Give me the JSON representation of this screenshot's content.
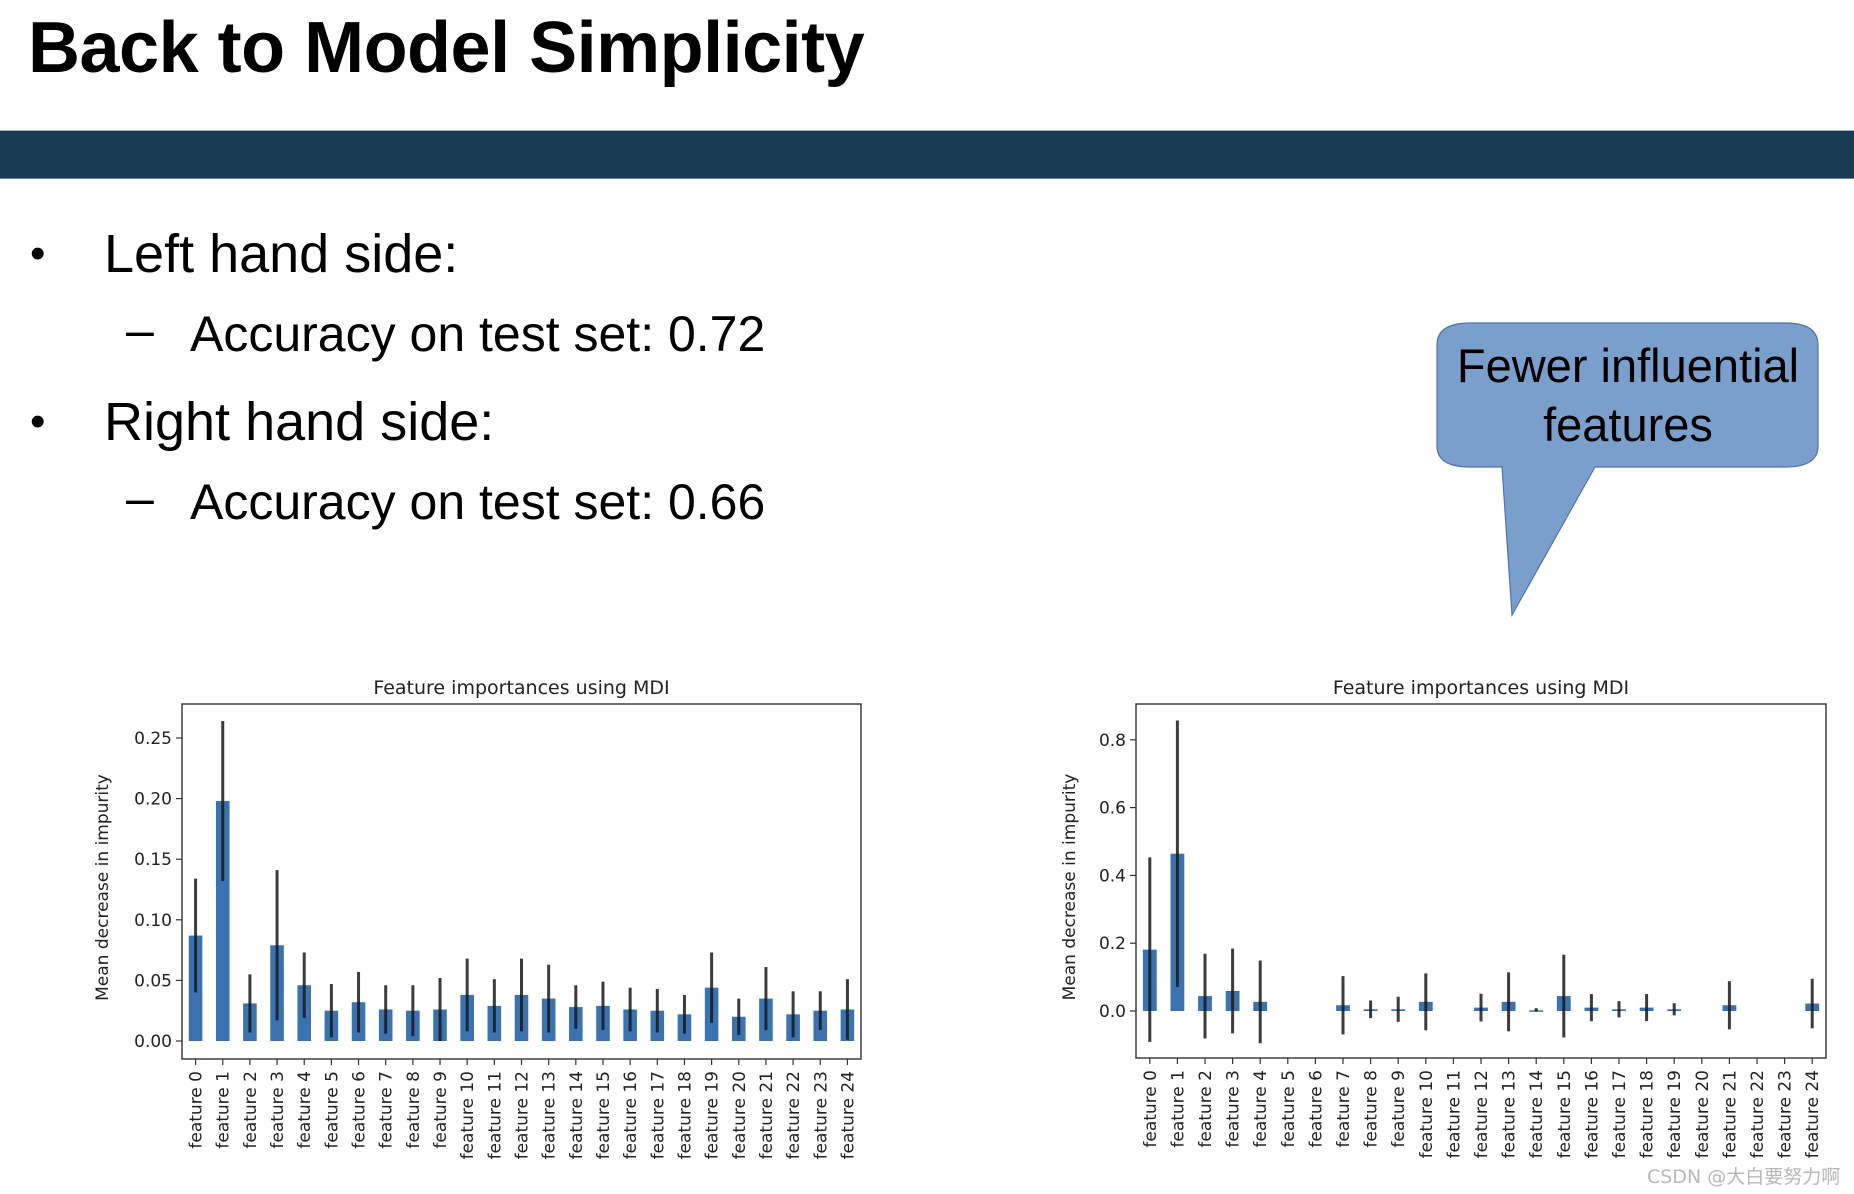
{
  "slide": {
    "title": "Back to Model Simplicity",
    "band_color": "#193a53",
    "bullets": [
      {
        "marker": "•",
        "text": "Left hand side:",
        "sub": {
          "marker": "–",
          "text": "Accuracy on test set: 0.72"
        }
      },
      {
        "marker": "•",
        "text": "Right hand side:",
        "sub": {
          "marker": "–",
          "text": "Accuracy on test set: 0.66"
        }
      }
    ],
    "callout": {
      "line1": "Fewer influential",
      "line2": "features",
      "fill": "#7b9fcc",
      "stroke": "#4f74a8"
    },
    "watermark": "CSDN @大白要努力啊"
  },
  "chart_data": [
    {
      "type": "bar",
      "title": "Feature importances using MDI",
      "xlabel": "",
      "ylabel": "Mean decrease in impurity",
      "ylim": [
        -0.017,
        0.275
      ],
      "yticks": [
        0.0,
        0.05,
        0.1,
        0.15,
        0.2,
        0.25
      ],
      "ytick_labels": [
        "0.00",
        "0.05",
        "0.10",
        "0.15",
        "0.20",
        "0.25"
      ],
      "grid": false,
      "bar_color": "#3a73b0",
      "errbar_color": "#1a1a1a",
      "categories": [
        "feature 0",
        "feature 1",
        "feature 2",
        "feature 3",
        "feature 4",
        "feature 5",
        "feature 6",
        "feature 7",
        "feature 8",
        "feature 9",
        "feature 10",
        "feature 11",
        "feature 12",
        "feature 13",
        "feature 14",
        "feature 15",
        "feature 16",
        "feature 17",
        "feature 18",
        "feature 19",
        "feature 20",
        "feature 21",
        "feature 22",
        "feature 23",
        "feature 24"
      ],
      "values": [
        0.087,
        0.198,
        0.031,
        0.079,
        0.046,
        0.025,
        0.032,
        0.026,
        0.025,
        0.026,
        0.038,
        0.029,
        0.038,
        0.035,
        0.028,
        0.029,
        0.026,
        0.025,
        0.022,
        0.044,
        0.02,
        0.035,
        0.022,
        0.025,
        0.026
      ],
      "error": [
        0.047,
        0.066,
        0.024,
        0.062,
        0.027,
        0.022,
        0.025,
        0.02,
        0.021,
        0.026,
        0.03,
        0.022,
        0.03,
        0.028,
        0.018,
        0.02,
        0.018,
        0.018,
        0.016,
        0.029,
        0.015,
        0.026,
        0.019,
        0.016,
        0.025
      ]
    },
    {
      "type": "bar",
      "title": "Feature importances using MDI",
      "xlabel": "",
      "ylabel": "Mean decrease in impurity",
      "ylim": [
        -0.14,
        0.9
      ],
      "yticks": [
        0.0,
        0.2,
        0.4,
        0.6,
        0.8
      ],
      "ytick_labels": [
        "0.0",
        "0.2",
        "0.4",
        "0.6",
        "0.8"
      ],
      "grid": false,
      "bar_color": "#3a73b0",
      "errbar_color": "#1a1a1a",
      "categories": [
        "feature 0",
        "feature 1",
        "feature 2",
        "feature 3",
        "feature 4",
        "feature 5",
        "feature 6",
        "feature 7",
        "feature 8",
        "feature 9",
        "feature 10",
        "feature 11",
        "feature 12",
        "feature 13",
        "feature 14",
        "feature 15",
        "feature 16",
        "feature 17",
        "feature 18",
        "feature 19",
        "feature 20",
        "feature 21",
        "feature 22",
        "feature 23",
        "feature 24"
      ],
      "values": [
        0.181,
        0.464,
        0.044,
        0.059,
        0.027,
        0.0,
        0.0,
        0.017,
        0.005,
        0.005,
        0.027,
        0.0,
        0.01,
        0.027,
        0.002,
        0.044,
        0.01,
        0.005,
        0.01,
        0.005,
        0.0,
        0.017,
        0.0,
        0.0,
        0.022
      ],
      "error": [
        0.272,
        0.393,
        0.125,
        0.125,
        0.122,
        0.0,
        0.0,
        0.086,
        0.026,
        0.037,
        0.084,
        0.0,
        0.041,
        0.087,
        0.0,
        0.122,
        0.04,
        0.024,
        0.04,
        0.018,
        0.0,
        0.071,
        0.0,
        0.0,
        0.073
      ]
    }
  ]
}
